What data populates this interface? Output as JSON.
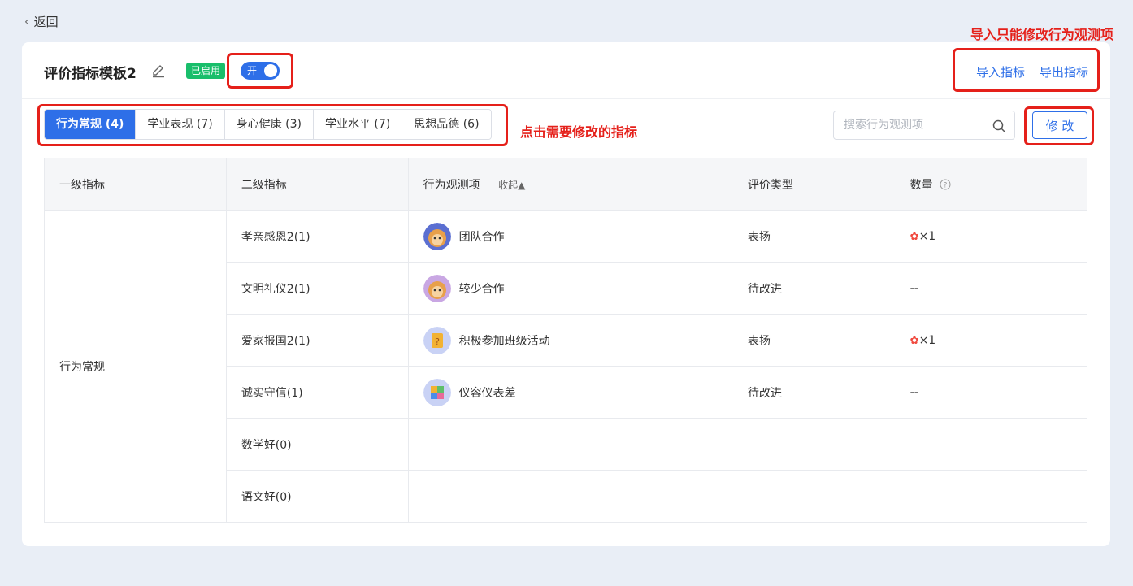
{
  "nav": {
    "back_label": "返回"
  },
  "annotations": {
    "top_right": "导入只能修改行为观测项",
    "tabs": "点击需要修改的指标"
  },
  "header": {
    "title": "评价指标模板2",
    "status_badge": "已启用",
    "toggle_label": "开",
    "toggle_on": true,
    "import_label": "导入指标",
    "export_label": "导出指标"
  },
  "tabs": [
    {
      "label": "行为常规 (4)",
      "active": true
    },
    {
      "label": "学业表现 (7)",
      "active": false
    },
    {
      "label": "身心健康 (3)",
      "active": false
    },
    {
      "label": "学业水平 (7)",
      "active": false
    },
    {
      "label": "思想品德 (6)",
      "active": false
    }
  ],
  "search": {
    "placeholder": "搜索行为观测项",
    "value": ""
  },
  "edit_button": "修 改",
  "table": {
    "headers": {
      "level1": "一级指标",
      "level2": "二级指标",
      "observation": "行为观测项",
      "collapse": "收起▲",
      "eval_type": "评价类型",
      "quantity": "数量"
    },
    "level1_value": "行为常规",
    "rows": [
      {
        "level2": "孝亲感恩2(1)",
        "observation": "团队合作",
        "avatar": "monkey-avatar",
        "eval_type": "表扬",
        "eval_red": false,
        "quantity": "×1",
        "has_flower": true
      },
      {
        "level2": "文明礼仪2(1)",
        "observation": "较少合作",
        "avatar": "monkey-avatar",
        "eval_type": "待改进",
        "eval_red": true,
        "quantity": "--",
        "has_flower": false
      },
      {
        "level2": "爱家报国2(1)",
        "observation": "积极参加班级活动",
        "avatar": "question-card-avatar",
        "eval_type": "表扬",
        "eval_red": false,
        "quantity": "×1",
        "has_flower": true
      },
      {
        "level2": "诚实守信(1)",
        "observation": "仪容仪表差",
        "avatar": "puzzle-avatar",
        "eval_type": "待改进",
        "eval_red": true,
        "quantity": "--",
        "has_flower": false
      },
      {
        "level2": "数学好(0)",
        "observation": "",
        "avatar": "",
        "eval_type": "",
        "eval_red": false,
        "quantity": "",
        "has_flower": false
      },
      {
        "level2": "语文好(0)",
        "observation": "",
        "avatar": "",
        "eval_type": "",
        "eval_red": false,
        "quantity": "",
        "has_flower": false
      }
    ]
  },
  "colors": {
    "primary": "#2e6fe8",
    "success": "#19be6b",
    "annotation": "#e5201a",
    "warning_text": "#f0493e"
  }
}
